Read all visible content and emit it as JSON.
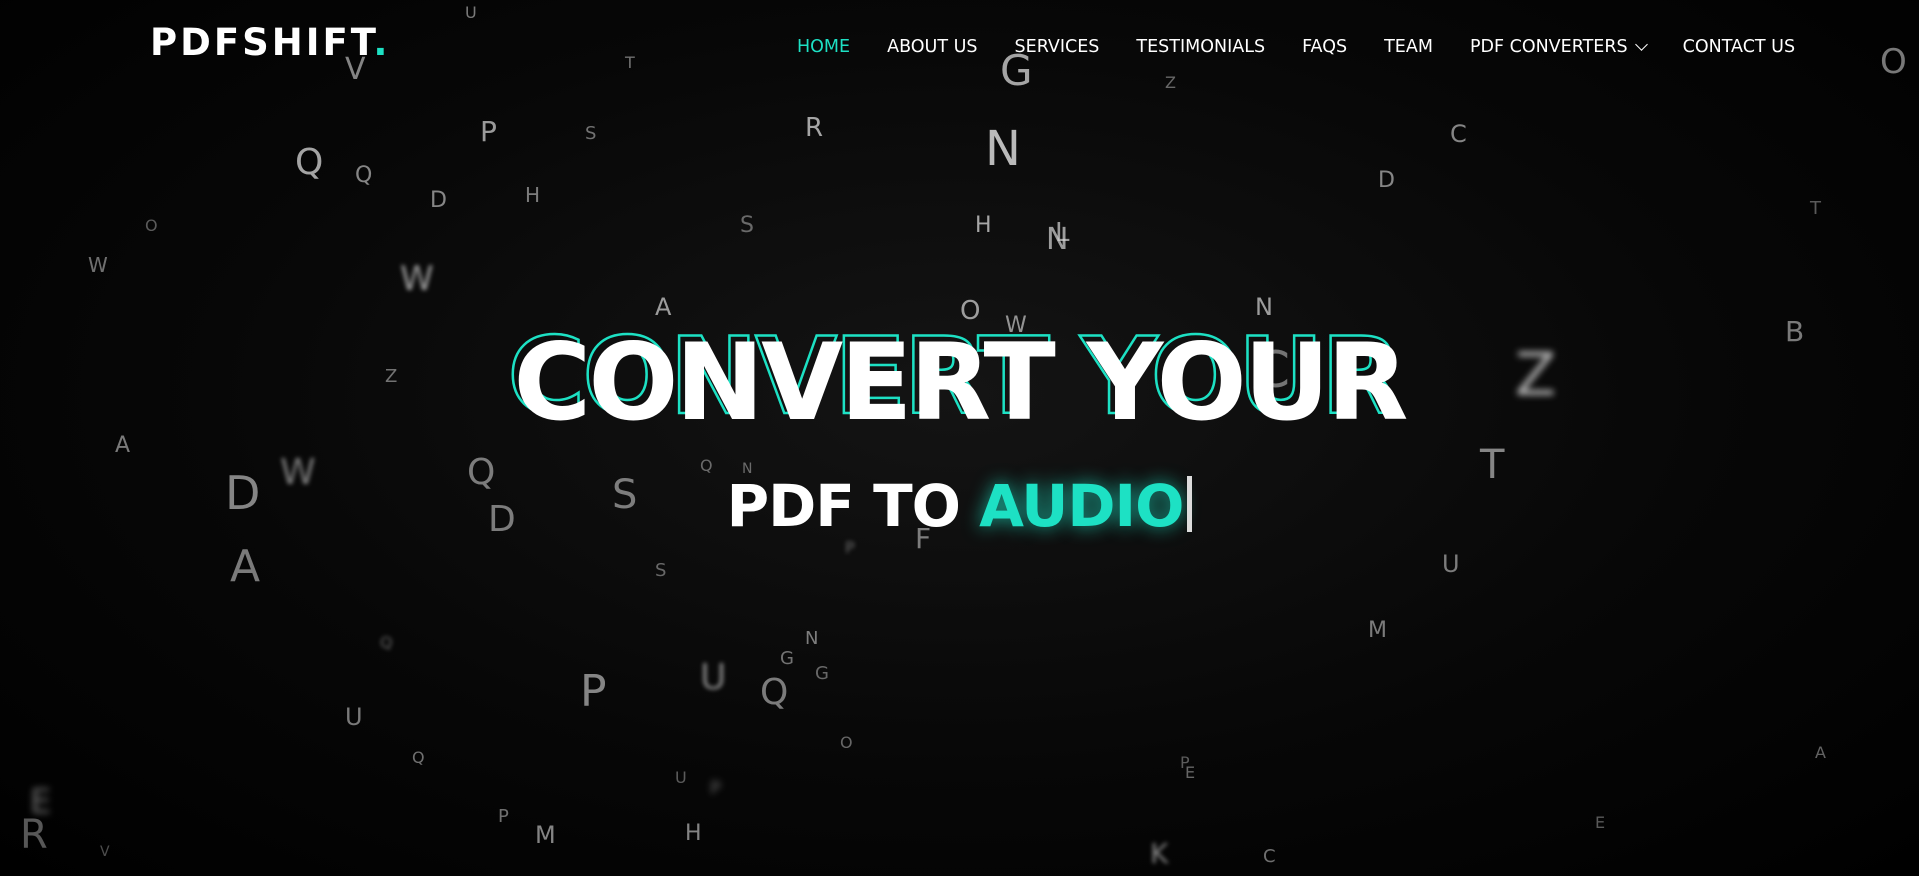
{
  "brand": {
    "name": "PDFSHIFT",
    "dot": "."
  },
  "colors": {
    "accent": "#1de1c4",
    "background": "#000000",
    "text": "#ffffff"
  },
  "nav": {
    "items": [
      {
        "label": "HOME",
        "active": true
      },
      {
        "label": "ABOUT US"
      },
      {
        "label": "SERVICES"
      },
      {
        "label": "TESTIMONIALS"
      },
      {
        "label": "FAQS"
      },
      {
        "label": "TEAM"
      },
      {
        "label": "PDF CONVERTERS",
        "dropdown": true,
        "icon": "chevron-down-icon"
      },
      {
        "label": "CONTACT US"
      }
    ]
  },
  "hero": {
    "headline": "CONVERT YOUR",
    "subline_prefix": "PDF TO ",
    "subline_highlight": "AUDIO"
  },
  "background_letters": [
    "U",
    "T",
    "V",
    "G",
    "Z",
    "O",
    "P",
    "S",
    "R",
    "N",
    "C",
    "D",
    "Q",
    "Q",
    "D",
    "H",
    "W",
    "L",
    "O",
    "T",
    "H",
    "N",
    "S",
    "N",
    "W",
    "A",
    "O",
    "W",
    "B",
    "Z",
    "Z",
    "C",
    "A",
    "T",
    "D",
    "W",
    "Q",
    "D",
    "S",
    "Q",
    "N",
    "U",
    "S",
    "F",
    "P",
    "A",
    "M",
    "N",
    "Q",
    "P",
    "U",
    "Q",
    "G",
    "G",
    "U",
    "Q",
    "O",
    "U",
    "P",
    "A",
    "E",
    "P",
    "M",
    "H",
    "K",
    "C",
    "E",
    "R",
    "V",
    "E",
    "P"
  ]
}
